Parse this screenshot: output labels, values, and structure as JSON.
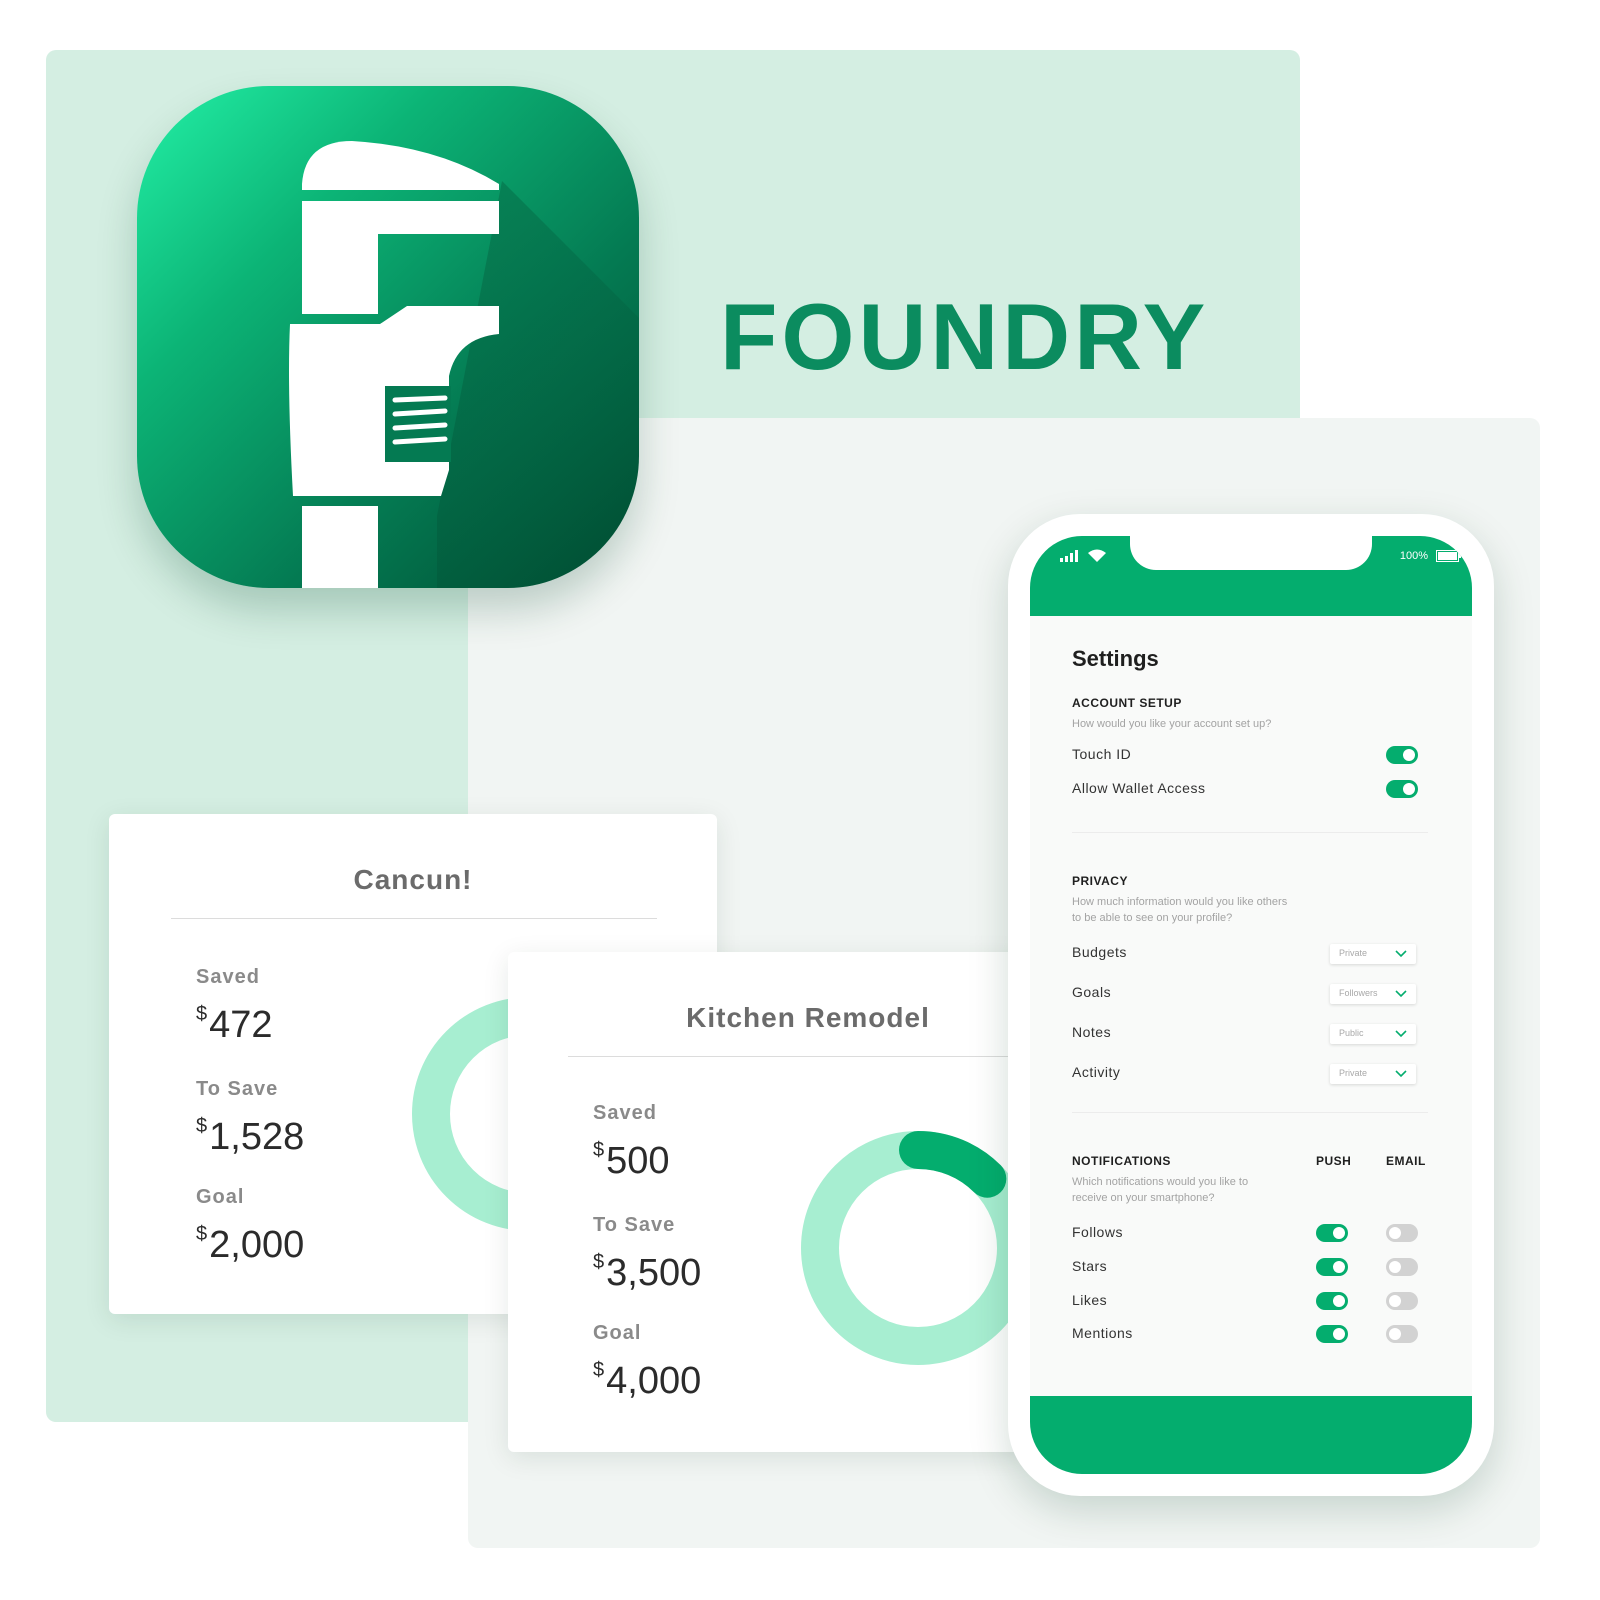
{
  "brand": {
    "name": "FOUNDRY"
  },
  "colors": {
    "accent": "#04ad6e",
    "accent_light": "#a7eed1",
    "mint_bg": "#d4eee2",
    "brand_text": "#0b8c5f"
  },
  "goal_cards": [
    {
      "title": "Cancun!",
      "saved_label": "Saved",
      "saved_currency": "$",
      "saved_value": "472",
      "to_save_label": "To Save",
      "to_save_currency": "$",
      "to_save_value": "1,528",
      "goal_label": "Goal",
      "goal_currency": "$",
      "goal_value": "2,000",
      "progress_fraction": 0.236
    },
    {
      "title": "Kitchen Remodel",
      "saved_label": "Saved",
      "saved_currency": "$",
      "saved_value": "500",
      "to_save_label": "To Save",
      "to_save_currency": "$",
      "to_save_value": "3,500",
      "goal_label": "Goal",
      "goal_currency": "$",
      "goal_value": "4,000",
      "progress_fraction": 0.125
    }
  ],
  "phone": {
    "status": {
      "battery": "100%",
      "icons": [
        "signal-icon",
        "wifi-icon",
        "battery-icon"
      ]
    },
    "settings": {
      "title": "Settings",
      "account": {
        "heading": "ACCOUNT SETUP",
        "description": "How would you like your account set up?",
        "items": [
          {
            "label": "Touch ID",
            "enabled": true
          },
          {
            "label": "Allow Wallet Access",
            "enabled": true
          }
        ]
      },
      "privacy": {
        "heading": "PRIVACY",
        "description": "How much information would you like others to be able to see on your profile?",
        "items": [
          {
            "label": "Budgets",
            "value": "Private"
          },
          {
            "label": "Goals",
            "value": "Followers"
          },
          {
            "label": "Notes",
            "value": "Public"
          },
          {
            "label": "Activity",
            "value": "Private"
          }
        ]
      },
      "notifications": {
        "heading": "NOTIFICATIONS",
        "push_label": "PUSH",
        "email_label": "EMAIL",
        "description": "Which notifications would you like to receive on your smartphone?",
        "items": [
          {
            "label": "Follows",
            "push": true,
            "email": false
          },
          {
            "label": "Stars",
            "push": true,
            "email": false
          },
          {
            "label": "Likes",
            "push": true,
            "email": false
          },
          {
            "label": "Mentions",
            "push": true,
            "email": false
          }
        ]
      }
    }
  }
}
